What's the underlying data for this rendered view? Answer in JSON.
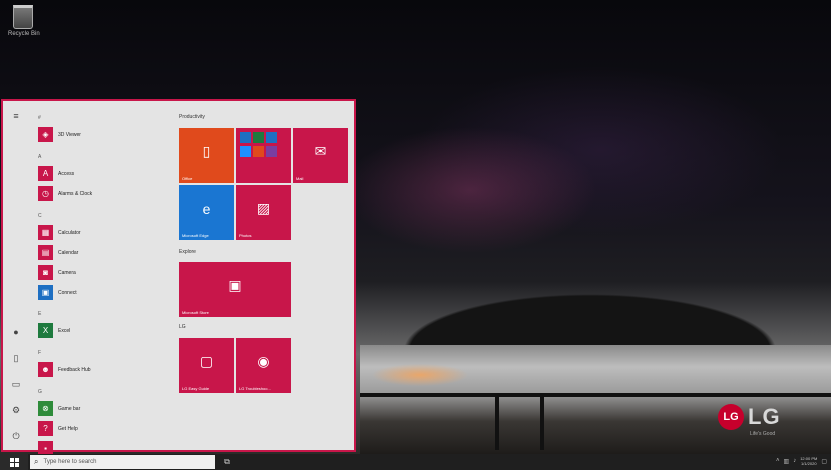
{
  "desktop": {
    "recycle_bin_label": "Recycle Bin",
    "brand_logo_text": "LG",
    "brand_logo_circle": "LG",
    "brand_sub": "Life's Good"
  },
  "start_menu": {
    "accent": "#c8164a",
    "rail_icons": [
      "hamburger-icon",
      "user-icon",
      "document-icon",
      "pictures-icon",
      "settings-icon",
      "power-icon"
    ],
    "sections": [
      {
        "letter": "#",
        "apps": [
          "3D Viewer"
        ]
      },
      {
        "letter": "A",
        "apps": [
          "Access",
          "Alarms & Clock"
        ]
      },
      {
        "letter": "C",
        "apps": [
          "Calculator",
          "Calendar",
          "Camera",
          "Connect"
        ]
      },
      {
        "letter": "E",
        "apps": [
          "Excel"
        ]
      },
      {
        "letter": "F",
        "apps": [
          "Feedback Hub"
        ]
      },
      {
        "letter": "G",
        "apps": [
          "Game bar",
          "Get Help"
        ]
      }
    ],
    "groups": {
      "productivity": {
        "title": "Productivity",
        "tiles": {
          "office": "Office",
          "mail": "Mail",
          "edge": "Microsoft Edge",
          "photos": "Photos"
        }
      },
      "explore": {
        "title": "Explore",
        "tiles": {
          "store": "Microsoft Store"
        }
      },
      "lg": {
        "title": "LG",
        "tiles": {
          "lg1": "LG Easy Guide",
          "lg2": "LG Troubleshoo..."
        }
      }
    }
  },
  "taskbar": {
    "search_placeholder": "Type here to search",
    "clock_time": "12:00 PM",
    "clock_date": "1/1/2020"
  }
}
